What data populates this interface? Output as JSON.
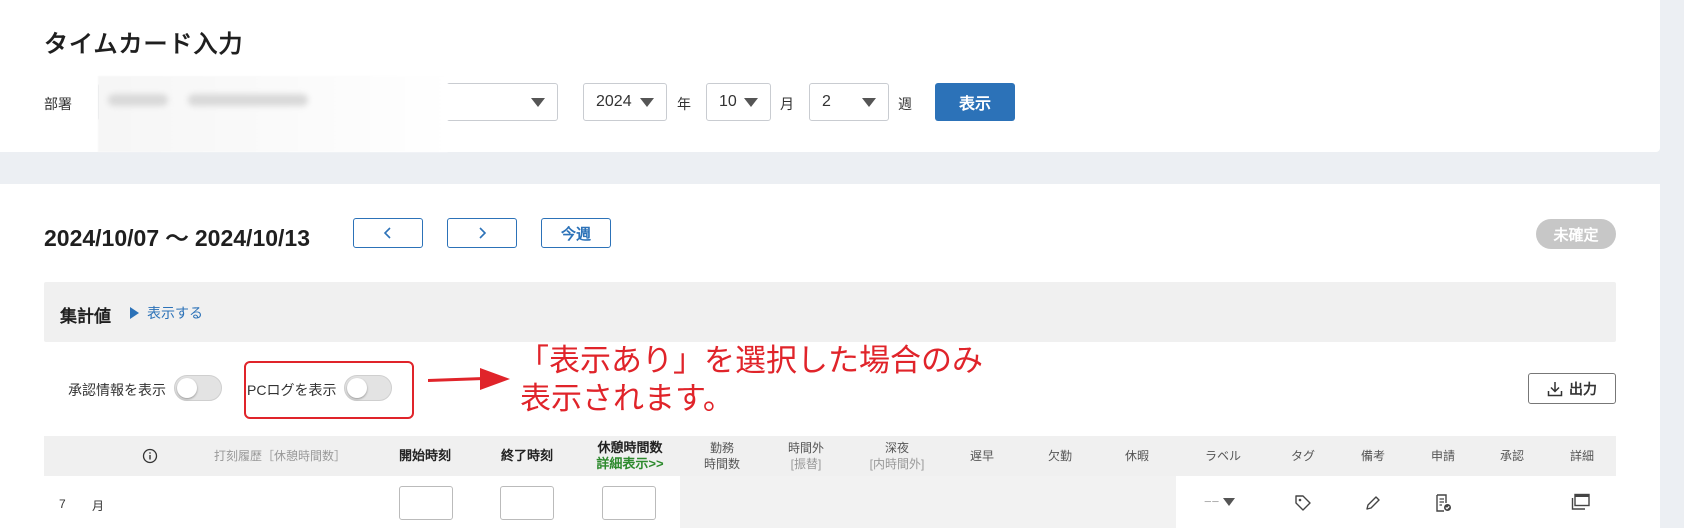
{
  "header": {
    "title": "タイムカード入力",
    "dept_label": "部署",
    "year_value": "2024",
    "year_unit": "年",
    "month_value": "10",
    "month_unit": "月",
    "week_value": "2",
    "week_unit": "週",
    "show_button": "表示"
  },
  "period": {
    "range": "2024/10/07 〜 2024/10/13",
    "prev_symbol": "<",
    "next_symbol": ">",
    "this_week": "今週",
    "status": "未確定"
  },
  "summary": {
    "title": "集計値",
    "toggle_link": "表示する"
  },
  "options": {
    "approval_label": "承認情報を表示",
    "approval_on": false,
    "pclog_label": "PCログを表示",
    "pclog_on": false,
    "export_label": "出力"
  },
  "annotation": {
    "line1": "「表示あり」を選択した場合のみ",
    "line2": "表示されます。"
  },
  "table": {
    "headers": {
      "info_icon": "info-icon",
      "punch_history": "打刻履歴［休憩時間数］",
      "start": "開始時刻",
      "end": "終了時刻",
      "break": "休憩時間数",
      "break_detail": "詳細表示>>",
      "work_1": "勤務",
      "work_2": "時間数",
      "overtime_1": "時間外",
      "overtime_2": "[振替]",
      "night_1": "深夜",
      "night_2": "[内時間外]",
      "late": "遅早",
      "absence": "欠勤",
      "leave": "休暇",
      "label": "ラベル",
      "tag": "タグ",
      "note": "備考",
      "request": "申請",
      "approval": "承認",
      "detail": "詳細"
    },
    "rows": [
      {
        "day": "7",
        "weekday": "月",
        "label_value": "−−"
      }
    ]
  },
  "colors": {
    "primary": "#2c72b8",
    "annotation_red": "#e0242a",
    "badge_gray": "#c7c7c7"
  }
}
